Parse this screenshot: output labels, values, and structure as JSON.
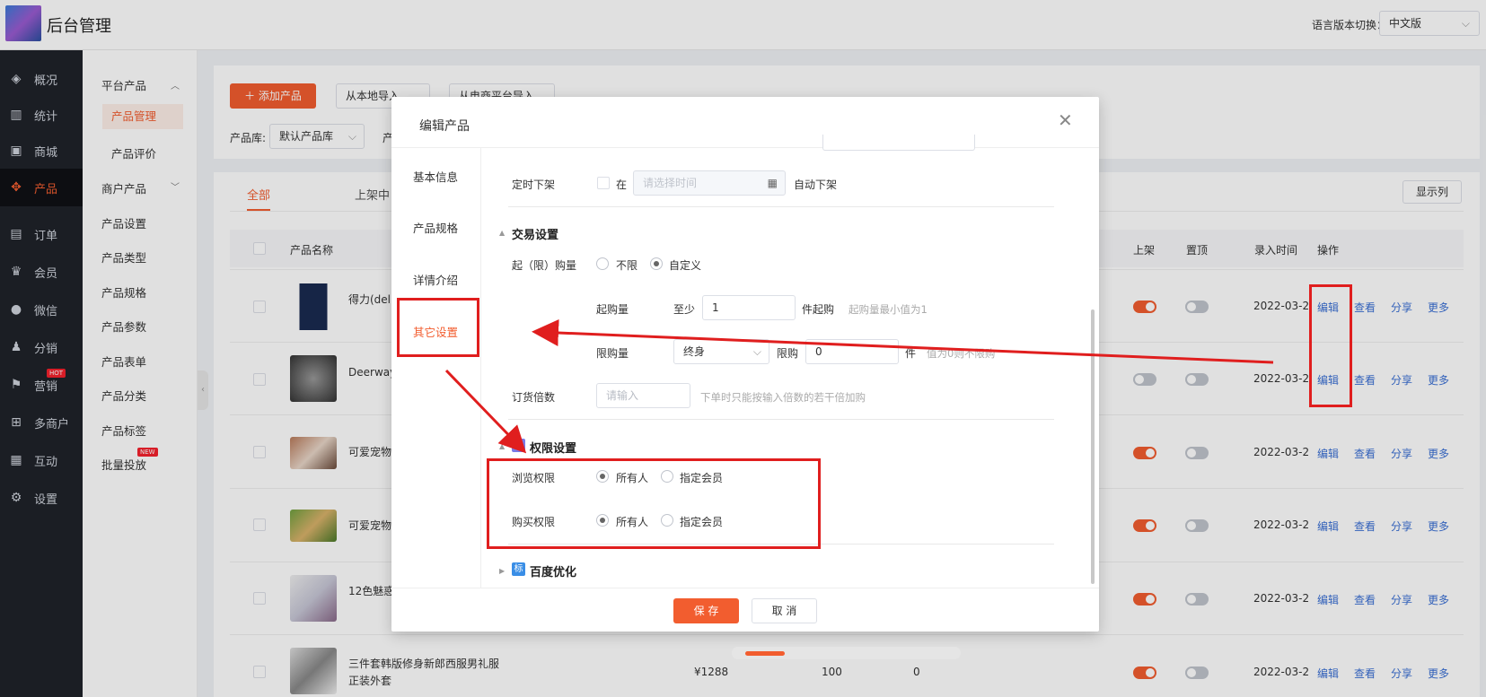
{
  "app": {
    "title": "后台管理",
    "lang_label": "语言版本切换：",
    "lang_value": "中文版"
  },
  "sidebar": {
    "items": [
      {
        "label": "概况",
        "icon": "layers-icon"
      },
      {
        "label": "统计",
        "icon": "chart-icon"
      },
      {
        "label": "商城",
        "icon": "store-icon"
      },
      {
        "label": "产品",
        "icon": "grid-icon"
      },
      {
        "label": "订单",
        "icon": "order-icon"
      },
      {
        "label": "会员",
        "icon": "crown-icon"
      },
      {
        "label": "微信",
        "icon": "wechat-icon"
      },
      {
        "label": "分销",
        "icon": "user-icon"
      },
      {
        "label": "营销",
        "icon": "flag-icon",
        "badge": "HOT"
      },
      {
        "label": "多商户",
        "icon": "merchant-icon"
      },
      {
        "label": "互动",
        "icon": "interact-icon"
      },
      {
        "label": "设置",
        "icon": "gear-icon"
      }
    ]
  },
  "submenu": {
    "group1": "平台产品",
    "group1_children": [
      "产品管理",
      "产品评价"
    ],
    "group2": "商户产品",
    "items": [
      "产品设置",
      "产品类型",
      "产品规格",
      "产品参数",
      "产品表单",
      "产品分类",
      "产品标签",
      "批量投放"
    ],
    "new_badge": "NEW"
  },
  "toolbar": {
    "add_label": "添加产品",
    "import_local": "从本地导入",
    "import_platform": "从电商平台导入",
    "lib_label": "产品库:",
    "lib_value": "默认产品库",
    "cut_label": "产"
  },
  "tabs": [
    "全部",
    "上架中"
  ],
  "columns_button": "显示列",
  "table": {
    "headers": {
      "name": "产品名称",
      "shelf": "上架",
      "top": "置顶",
      "time": "录入时间",
      "ops": "操作"
    },
    "rows": [
      {
        "name": "得力(deli... 鼓 碳粉盒",
        "date": "2022-03-2",
        "shelf": true
      },
      {
        "name": "Deerway... 鞋春季新...",
        "date": "2022-03-2",
        "shelf": false
      },
      {
        "name": "可爱宠物...",
        "date": "2022-03-2",
        "shelf": true
      },
      {
        "name": "可爱宠物...",
        "date": "2022-03-2",
        "shelf": true
      },
      {
        "name": "12色魅惑... 地色",
        "date": "2022-03-2",
        "shelf": true
      },
      {
        "name": "三件套韩版修身新郎西服男礼服正装外套",
        "price": "¥1288",
        "stock": "100",
        "sales": "0",
        "date": "2022-03-2",
        "shelf": true
      }
    ],
    "actions": [
      "编辑",
      "查看",
      "分享",
      "更多"
    ]
  },
  "modal": {
    "title": "编辑产品",
    "nav": [
      "基本信息",
      "产品规格",
      "详情介绍",
      "其它设置"
    ],
    "timed_off": {
      "label": "定时下架",
      "at": "在",
      "placeholder": "请选择时间",
      "suffix": "自动下架"
    },
    "trade": {
      "title": "交易设置",
      "limit_label": "起（限）购量",
      "opt_unlimited": "不限",
      "opt_custom": "自定义",
      "min_label": "起购量",
      "min_prefix": "至少",
      "min_value": "1",
      "min_suffix": "件起购",
      "min_hint": "起购量最小值为1",
      "max_label": "限购量",
      "max_period": "终身",
      "max_prefix": "限购",
      "max_value": "0",
      "max_suffix": "件",
      "max_hint": "值为0则不限购",
      "multiple_label": "订货倍数",
      "multiple_placeholder": "请输入",
      "multiple_hint": "下单时只能按输入倍数的若干倍加购"
    },
    "perm": {
      "title": "权限设置",
      "icon_text": "素",
      "browse_label": "浏览权限",
      "buy_label": "购买权限",
      "opt_all": "所有人",
      "opt_member": "指定会员"
    },
    "seo": {
      "title": "百度优化",
      "icon_text": "标"
    },
    "save": "保 存",
    "cancel": "取 消"
  }
}
